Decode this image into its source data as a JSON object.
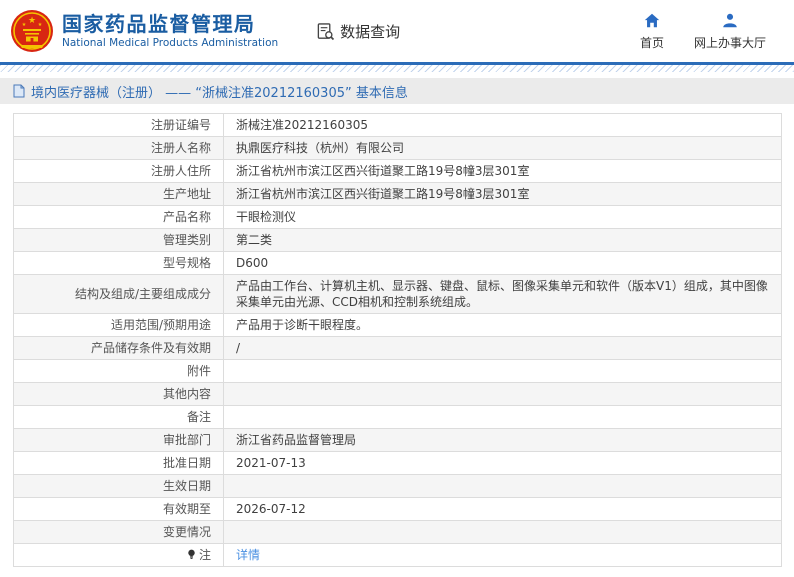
{
  "header": {
    "org_name_cn": "国家药品监督管理局",
    "org_name_en": "National Medical Products Administration",
    "section_label": "数据查询",
    "nav": [
      {
        "label": "首页"
      },
      {
        "label": "网上办事大厅"
      }
    ]
  },
  "page_title": "境内医疗器械（注册） —— “浙械注准20212160305” 基本信息",
  "table": {
    "rows": [
      {
        "label": "注册证编号",
        "value": "浙械注准20212160305"
      },
      {
        "label": "注册人名称",
        "value": "执鼎医疗科技（杭州）有限公司"
      },
      {
        "label": "注册人住所",
        "value": "浙江省杭州市滨江区西兴街道聚工路19号8幢3层301室"
      },
      {
        "label": "生产地址",
        "value": "浙江省杭州市滨江区西兴街道聚工路19号8幢3层301室"
      },
      {
        "label": "产品名称",
        "value": "干眼检测仪"
      },
      {
        "label": "管理类别",
        "value": "第二类"
      },
      {
        "label": "型号规格",
        "value": "D600"
      },
      {
        "label": "结构及组成/主要组成成分",
        "value": "产品由工作台、计算机主机、显示器、键盘、鼠标、图像采集单元和软件（版本V1）组成，其中图像采集单元由光源、CCD相机和控制系统组成。"
      },
      {
        "label": "适用范围/预期用途",
        "value": "产品用于诊断干眼程度。"
      },
      {
        "label": "产品储存条件及有效期",
        "value": "/"
      },
      {
        "label": "附件",
        "value": ""
      },
      {
        "label": "其他内容",
        "value": ""
      },
      {
        "label": "备注",
        "value": ""
      },
      {
        "label": "审批部门",
        "value": "浙江省药品监督管理局"
      },
      {
        "label": "批准日期",
        "value": "2021-07-13"
      },
      {
        "label": "生效日期",
        "value": ""
      },
      {
        "label": "有效期至",
        "value": "2026-07-12"
      },
      {
        "label": "变更情况",
        "value": ""
      },
      {
        "label": "注",
        "value": "详情"
      }
    ]
  },
  "colors": {
    "accent_blue": "#1a5da2",
    "nav_icon_blue": "#2a6bc2",
    "link_blue": "#4a90e2",
    "emblem_red": "#d82612",
    "emblem_gold": "#f5c400",
    "header_line_blue": "#2b6cb8",
    "title_bar_bg": "#ebebeb",
    "row_alt_bg": "#f5f5f5",
    "table_border": "#dcdcdc"
  }
}
